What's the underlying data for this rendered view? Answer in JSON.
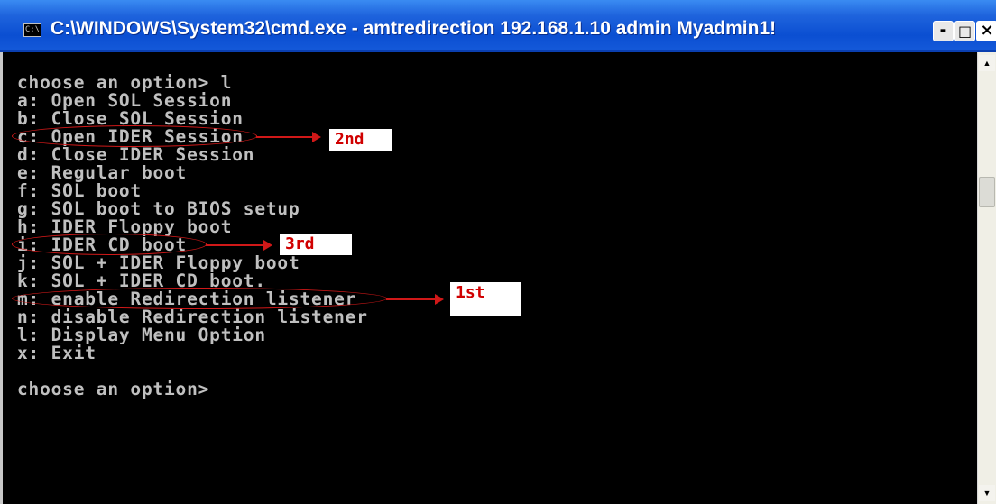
{
  "window": {
    "icon_text": "C:\\",
    "title": "C:\\WINDOWS\\System32\\cmd.exe - amtredirection 192.168.1.10 admin Myadmin1!",
    "controls": {
      "minimize": "-",
      "maximize": "□",
      "close": "×"
    }
  },
  "console": {
    "lines": [
      "choose an option> l",
      "a: Open SOL Session",
      "b: Close SOL Session",
      "c: Open IDER Session",
      "d: Close IDER Session",
      "e: Regular boot",
      "f: SOL boot",
      "g: SOL boot to BIOS setup",
      "h: IDER Floppy boot",
      "i: IDER CD boot",
      "j: SOL + IDER Floppy boot",
      "k: SOL + IDER CD boot.",
      "m: enable Redirection listener",
      "n: disable Redirection listener",
      "l: Display Menu Option",
      "x: Exit",
      "",
      "choose an option>"
    ]
  },
  "annotations": {
    "first": "1st",
    "second": "2nd",
    "third": "3rd",
    "color": "#d01818"
  },
  "scrollbar": {
    "up": "▲",
    "down": "▼"
  }
}
